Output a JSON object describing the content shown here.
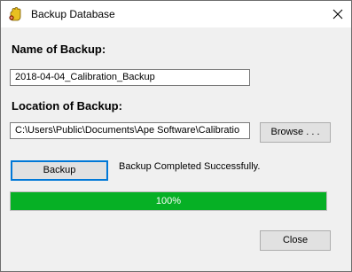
{
  "window": {
    "title": "Backup Database",
    "app_icon": "hand-gear-icon",
    "close_icon": "close-icon"
  },
  "form": {
    "name_label": "Name of Backup:",
    "name_value": "2018-04-04_Calibration_Backup",
    "location_label": "Location of Backup:",
    "location_value": "C:\\Users\\Public\\Documents\\Ape Software\\Calibratio",
    "browse_label": "Browse . . .",
    "backup_label": "Backup",
    "status_text": "Backup Completed Successfully.",
    "close_label": "Close"
  },
  "progress": {
    "value_percent": 100,
    "text": "100%",
    "fill_color": "#06b025"
  }
}
